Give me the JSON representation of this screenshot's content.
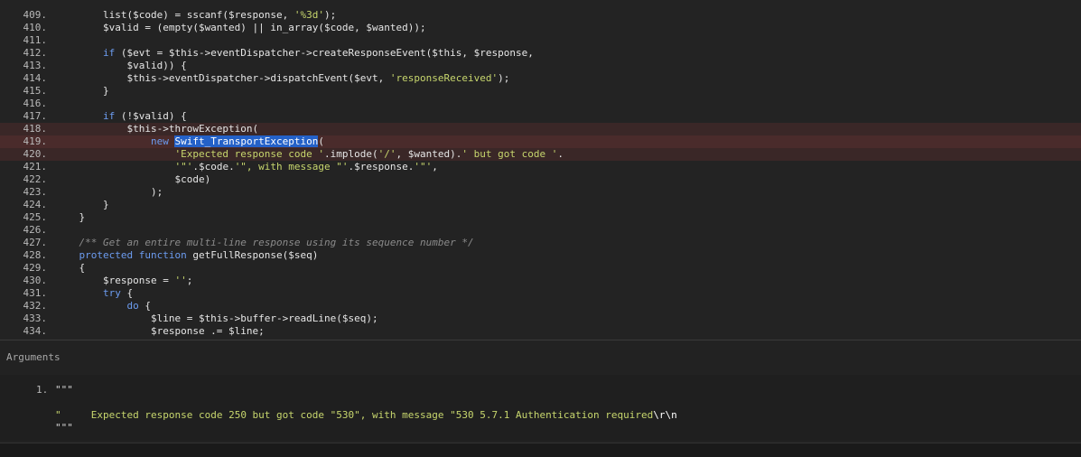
{
  "code": {
    "lines": [
      {
        "n": "409.",
        "hl": "",
        "segs": [
          [
            "t",
            "        list($code) = sscanf($response, "
          ],
          [
            "str",
            "'%3d'"
          ],
          [
            "t",
            ");"
          ]
        ]
      },
      {
        "n": "410.",
        "hl": "",
        "segs": [
          [
            "t",
            "        $valid = (empty($wanted) || in_array($code, $wanted));"
          ]
        ]
      },
      {
        "n": "411.",
        "hl": "",
        "segs": []
      },
      {
        "n": "412.",
        "hl": "",
        "segs": [
          [
            "kw",
            "        if"
          ],
          [
            "t",
            " ($evt = $this->eventDispatcher->createResponseEvent($this, $response,"
          ]
        ]
      },
      {
        "n": "413.",
        "hl": "",
        "segs": [
          [
            "t",
            "            $valid)) {"
          ]
        ]
      },
      {
        "n": "414.",
        "hl": "",
        "segs": [
          [
            "t",
            "            $this->eventDispatcher->dispatchEvent($evt, "
          ],
          [
            "str",
            "'responseReceived'"
          ],
          [
            "t",
            ");"
          ]
        ]
      },
      {
        "n": "415.",
        "hl": "",
        "segs": [
          [
            "t",
            "        }"
          ]
        ]
      },
      {
        "n": "416.",
        "hl": "",
        "segs": []
      },
      {
        "n": "417.",
        "hl": "",
        "segs": [
          [
            "kw",
            "        if"
          ],
          [
            "t",
            " (!$valid) {"
          ]
        ]
      },
      {
        "n": "418.",
        "hl": "hl",
        "segs": [
          [
            "t",
            "            $this->throwException("
          ]
        ]
      },
      {
        "n": "419.",
        "hl": "hl-strong",
        "segs": [
          [
            "kw",
            "                new"
          ],
          [
            "t",
            " "
          ],
          [
            "sel",
            "Swift_TransportException"
          ],
          [
            "t",
            "("
          ]
        ]
      },
      {
        "n": "420.",
        "hl": "hl",
        "segs": [
          [
            "str",
            "                    'Expected response code '"
          ],
          [
            "t",
            ".implode("
          ],
          [
            "str",
            "'/'"
          ],
          [
            "t",
            ", $wanted)."
          ],
          [
            "str",
            "' but got code '"
          ],
          [
            "t",
            "."
          ]
        ]
      },
      {
        "n": "421.",
        "hl": "",
        "segs": [
          [
            "str",
            "                    '\"'"
          ],
          [
            "t",
            ".$code."
          ],
          [
            "str",
            "'\", with message \"'"
          ],
          [
            "t",
            ".$response."
          ],
          [
            "str",
            "'\"'"
          ],
          [
            "t",
            ","
          ]
        ]
      },
      {
        "n": "422.",
        "hl": "",
        "segs": [
          [
            "t",
            "                    $code)"
          ]
        ]
      },
      {
        "n": "423.",
        "hl": "",
        "segs": [
          [
            "t",
            "                );"
          ]
        ]
      },
      {
        "n": "424.",
        "hl": "",
        "segs": [
          [
            "t",
            "        }"
          ]
        ]
      },
      {
        "n": "425.",
        "hl": "",
        "segs": [
          [
            "t",
            "    }"
          ]
        ]
      },
      {
        "n": "426.",
        "hl": "",
        "segs": []
      },
      {
        "n": "427.",
        "hl": "",
        "segs": [
          [
            "cm",
            "    /** Get an entire multi-line response using its sequence number */"
          ]
        ]
      },
      {
        "n": "428.",
        "hl": "",
        "segs": [
          [
            "kw",
            "    protected function"
          ],
          [
            "t",
            " getFullResponse($seq)"
          ]
        ]
      },
      {
        "n": "429.",
        "hl": "",
        "segs": [
          [
            "t",
            "    {"
          ]
        ]
      },
      {
        "n": "430.",
        "hl": "",
        "segs": [
          [
            "t",
            "        $response = "
          ],
          [
            "str",
            "''"
          ],
          [
            "t",
            ";"
          ]
        ]
      },
      {
        "n": "431.",
        "hl": "",
        "segs": [
          [
            "kw",
            "        try"
          ],
          [
            "t",
            " {"
          ]
        ]
      },
      {
        "n": "432.",
        "hl": "",
        "segs": [
          [
            "kw",
            "            do"
          ],
          [
            "t",
            " {"
          ]
        ]
      },
      {
        "n": "433.",
        "hl": "",
        "segs": [
          [
            "t",
            "                $line = $this->buffer->readLine($seq);"
          ]
        ]
      },
      {
        "n": "434.",
        "hl": "",
        "segs": [
          [
            "t",
            "                $response .= $line;"
          ]
        ]
      }
    ]
  },
  "arguments": {
    "title": "Arguments",
    "items": [
      {
        "num": "1.",
        "open_quote": "\"\"\"",
        "text": "Expected response code 250 but got code \"530\", with message \"530 5.7.1 Authentication required",
        "escape": "\\r\\n",
        "cont": "\"",
        "close_quote": "\"\"\""
      }
    ]
  }
}
